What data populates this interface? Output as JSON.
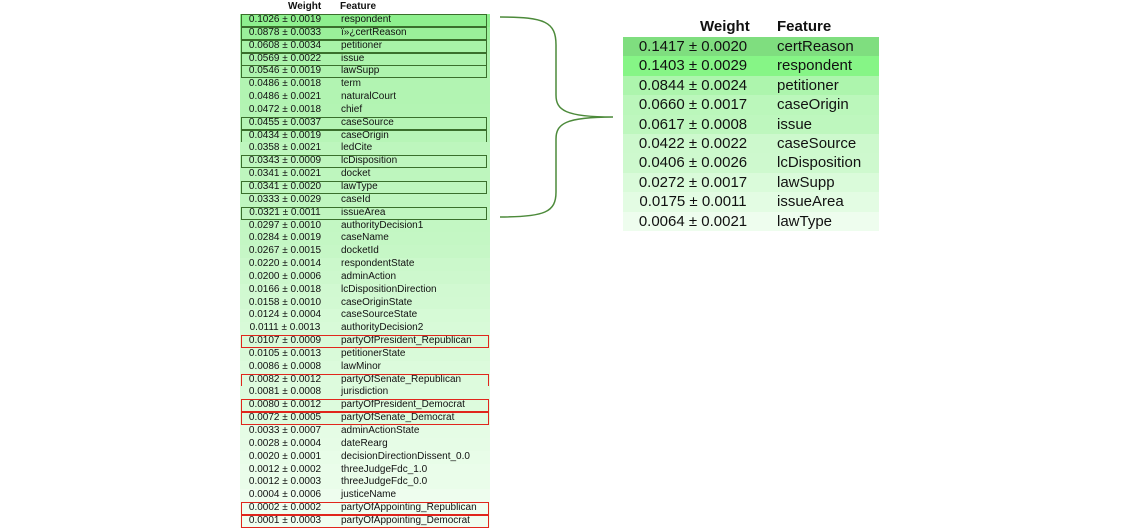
{
  "left": {
    "header": {
      "weight": "Weight",
      "feature": "Feature"
    },
    "rows": [
      {
        "weight": "0.1026 ± 0.0019",
        "feature": "respondent",
        "color": "#8ef08e",
        "box": "green"
      },
      {
        "weight": "0.0878 ± 0.0033",
        "feature": "ï»¿certReason",
        "color": "#9af09a",
        "box": "green"
      },
      {
        "weight": "0.0608 ± 0.0034",
        "feature": "petitioner",
        "color": "#a8f3a8",
        "box": "green"
      },
      {
        "weight": "0.0569 ± 0.0022",
        "feature": "issue",
        "color": "#acf3ac",
        "box": "green"
      },
      {
        "weight": "0.0546 ± 0.0019",
        "feature": "lawSupp",
        "color": "#aef4ae",
        "box": "green"
      },
      {
        "weight": "0.0486 ± 0.0018",
        "feature": "term",
        "color": "#b2f4b2",
        "box": ""
      },
      {
        "weight": "0.0486 ± 0.0021",
        "feature": "naturalCourt",
        "color": "#b2f4b2",
        "box": ""
      },
      {
        "weight": "0.0472 ± 0.0018",
        "feature": "chief",
        "color": "#b3f4b3",
        "box": ""
      },
      {
        "weight": "0.0455 ± 0.0037",
        "feature": "caseSource",
        "color": "#b5f5b5",
        "box": "green"
      },
      {
        "weight": "0.0434 ± 0.0019",
        "feature": "caseOrigin",
        "color": "#b7f5b7",
        "box": "green"
      },
      {
        "weight": "0.0358 ± 0.0021",
        "feature": "ledCite",
        "color": "#bdf6bd",
        "box": ""
      },
      {
        "weight": "0.0343 ± 0.0009",
        "feature": "lcDisposition",
        "color": "#bef6be",
        "box": "green"
      },
      {
        "weight": "0.0341 ± 0.0021",
        "feature": "docket",
        "color": "#bef6be",
        "box": ""
      },
      {
        "weight": "0.0341 ± 0.0020",
        "feature": "lawType",
        "color": "#bef6be",
        "box": "green"
      },
      {
        "weight": "0.0333 ± 0.0029",
        "feature": "caseId",
        "color": "#bff6bf",
        "box": ""
      },
      {
        "weight": "0.0321 ± 0.0011",
        "feature": "issueArea",
        "color": "#c0f6c0",
        "box": "green"
      },
      {
        "weight": "0.0297 ± 0.0010",
        "feature": "authorityDecision1",
        "color": "#c3f7c3",
        "box": ""
      },
      {
        "weight": "0.0284 ± 0.0019",
        "feature": "caseName",
        "color": "#c4f7c4",
        "box": ""
      },
      {
        "weight": "0.0267 ± 0.0015",
        "feature": "docketId",
        "color": "#c6f7c6",
        "box": ""
      },
      {
        "weight": "0.0220 ± 0.0014",
        "feature": "respondentState",
        "color": "#cbf8cb",
        "box": ""
      },
      {
        "weight": "0.0200 ± 0.0006",
        "feature": "adminAction",
        "color": "#cdf8cd",
        "box": ""
      },
      {
        "weight": "0.0166 ± 0.0018",
        "feature": "lcDispositionDirection",
        "color": "#d1f9d1",
        "box": ""
      },
      {
        "weight": "0.0158 ± 0.0010",
        "feature": "caseOriginState",
        "color": "#d2f9d2",
        "box": ""
      },
      {
        "weight": "0.0124 ± 0.0004",
        "feature": "caseSourceState",
        "color": "#d6fad6",
        "box": ""
      },
      {
        "weight": "0.0111 ± 0.0013",
        "feature": "authorityDecision2",
        "color": "#d8fad8",
        "box": ""
      },
      {
        "weight": "0.0107 ± 0.0009",
        "feature": "partyOfPresident_Republican",
        "color": "#d9fad9",
        "box": "red"
      },
      {
        "weight": "0.0105 ± 0.0013",
        "feature": "petitionerState",
        "color": "#d9fad9",
        "box": ""
      },
      {
        "weight": "0.0086 ± 0.0008",
        "feature": "lawMinor",
        "color": "#dcfbdc",
        "box": ""
      },
      {
        "weight": "0.0082 ± 0.0012",
        "feature": "partyOfSenate_Republican",
        "color": "#ddfbdd",
        "box": "red"
      },
      {
        "weight": "0.0081 ± 0.0008",
        "feature": "jurisdiction",
        "color": "#ddfbdd",
        "box": ""
      },
      {
        "weight": "0.0080 ± 0.0012",
        "feature": "partyOfPresident_Democrat",
        "color": "#ddfbdd",
        "box": "red"
      },
      {
        "weight": "0.0072 ± 0.0005",
        "feature": "partyOfSenate_Democrat",
        "color": "#defbde",
        "box": "red"
      },
      {
        "weight": "0.0033 ± 0.0007",
        "feature": "adminActionState",
        "color": "#e5fce5",
        "box": ""
      },
      {
        "weight": "0.0028 ± 0.0004",
        "feature": "dateRearg",
        "color": "#e6fce6",
        "box": ""
      },
      {
        "weight": "0.0020 ± 0.0001",
        "feature": "decisionDirectionDissent_0.0",
        "color": "#e8fde8",
        "box": ""
      },
      {
        "weight": "0.0012 ± 0.0002",
        "feature": "threeJudgeFdc_1.0",
        "color": "#eafdea",
        "box": ""
      },
      {
        "weight": "0.0012 ± 0.0003",
        "feature": "threeJudgeFdc_0.0",
        "color": "#eafdea",
        "box": ""
      },
      {
        "weight": "0.0004 ± 0.0006",
        "feature": "justiceName",
        "color": "#eefdee",
        "box": ""
      },
      {
        "weight": "0.0002 ± 0.0002",
        "feature": "partyOfAppointing_Republican",
        "color": "#effeef",
        "box": "red"
      },
      {
        "weight": "0.0001 ± 0.0003",
        "feature": "partyOfAppointing_Democrat",
        "color": "#f0fef0",
        "box": "red"
      }
    ]
  },
  "right": {
    "header": {
      "weight": "Weight",
      "feature": "Feature"
    },
    "rows": [
      {
        "weight": "0.1417 ± 0.0020",
        "feature": "certReason",
        "color": "#7fde7f"
      },
      {
        "weight": "0.1403 ± 0.0029",
        "feature": "respondent",
        "color": "#86f586"
      },
      {
        "weight": "0.0844 ± 0.0024",
        "feature": "petitioner",
        "color": "#adf5ad"
      },
      {
        "weight": "0.0660 ± 0.0017",
        "feature": "caseOrigin",
        "color": "#bbf7bb"
      },
      {
        "weight": "0.0617 ± 0.0008",
        "feature": "issue",
        "color": "#bef7be"
      },
      {
        "weight": "0.0422 ± 0.0022",
        "feature": "caseSource",
        "color": "#cdf9cd"
      },
      {
        "weight": "0.0406 ± 0.0026",
        "feature": "lcDisposition",
        "color": "#cef9ce"
      },
      {
        "weight": "0.0272 ± 0.0017",
        "feature": "lawSupp",
        "color": "#dafbda"
      },
      {
        "weight": "0.0175 ± 0.0011",
        "feature": "issueArea",
        "color": "#e3fce3"
      },
      {
        "weight": "0.0064 ± 0.0021",
        "feature": "lawType",
        "color": "#eefdee"
      }
    ]
  },
  "colors": {
    "green_box": "#3a6f2c",
    "red_box": "#e0261c",
    "brace": "#4c8a3a"
  }
}
